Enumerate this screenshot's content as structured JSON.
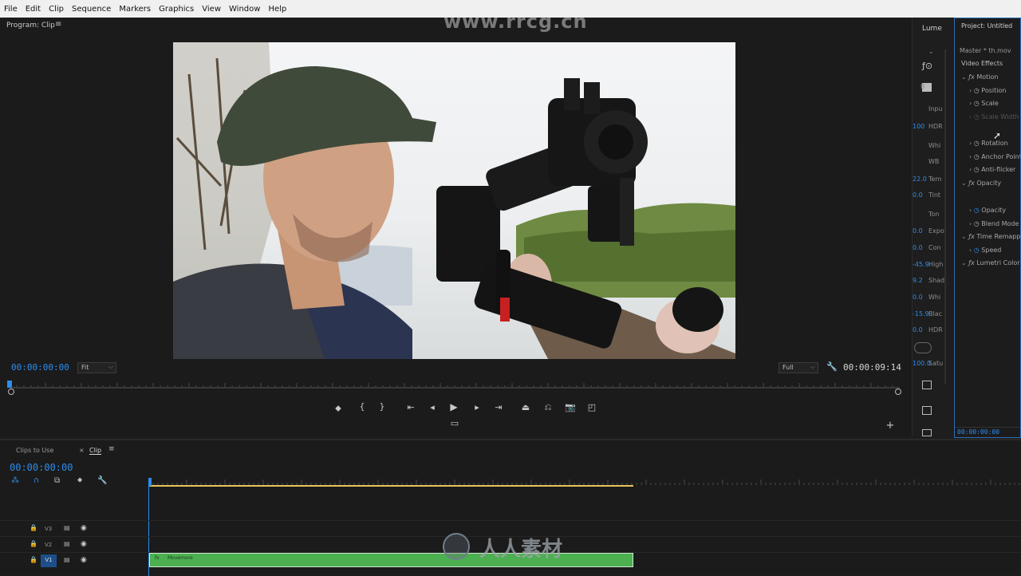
{
  "menu": [
    "File",
    "Edit",
    "Clip",
    "Sequence",
    "Markers",
    "Graphics",
    "View",
    "Window",
    "Help"
  ],
  "watermark": "www.rrcg.cn",
  "program": {
    "title": "Program: Clip",
    "current_tc": "00:00:00:00",
    "fit": "Fit",
    "resolution": "Full",
    "duration_tc": "00:00:09:14"
  },
  "lumetri": {
    "tab": "Lume",
    "rows": [
      {
        "val": "",
        "label": "B"
      },
      {
        "val": "",
        "label": "Inpu"
      },
      {
        "val": "100",
        "label": "HDR"
      },
      {
        "val": "",
        "label": "Whi"
      },
      {
        "val": "",
        "label": "WB"
      },
      {
        "val": "22.0",
        "label": "Tem"
      },
      {
        "val": "0.0",
        "label": "Tint"
      },
      {
        "val": "",
        "label": "Ton"
      },
      {
        "val": "0.0",
        "label": "Expo"
      },
      {
        "val": "0.0",
        "label": "Con"
      },
      {
        "val": "-45.9",
        "label": "High"
      },
      {
        "val": "9.2",
        "label": "Shad"
      },
      {
        "val": "0.0",
        "label": "Whi"
      },
      {
        "val": "-15.9",
        "label": "Blac"
      },
      {
        "val": "0.0",
        "label": "HDR"
      },
      {
        "val": "100.0",
        "label": "Satu"
      }
    ]
  },
  "effects": {
    "title": "Project: Untitled",
    "master": "Master * th.mov",
    "section": "Video Effects",
    "items": [
      {
        "label": "Motion",
        "kind": "fx"
      },
      {
        "label": "Position",
        "kind": "param"
      },
      {
        "label": "Scale",
        "kind": "param"
      },
      {
        "label": "Scale Width",
        "kind": "param-disabled"
      },
      {
        "label": "Rotation",
        "kind": "param"
      },
      {
        "label": "Anchor Point",
        "kind": "param"
      },
      {
        "label": "Anti-flicker",
        "kind": "param"
      },
      {
        "label": "Opacity",
        "kind": "fx"
      },
      {
        "label": "Opacity",
        "kind": "param"
      },
      {
        "label": "Blend Mode",
        "kind": "param"
      },
      {
        "label": "Time Remapping",
        "kind": "fx"
      },
      {
        "label": "Speed",
        "kind": "param"
      },
      {
        "label": "Lumetri Color",
        "kind": "fx"
      }
    ],
    "bottom_tc": "00:00:00:00"
  },
  "timeline": {
    "tabs": [
      "Clips to Use",
      "Clip"
    ],
    "tc": "00:00:00:00",
    "tracks": [
      "V3",
      "V2",
      "V1"
    ],
    "clip_name": "Movemore"
  },
  "bottom_watermark": "人人素材"
}
